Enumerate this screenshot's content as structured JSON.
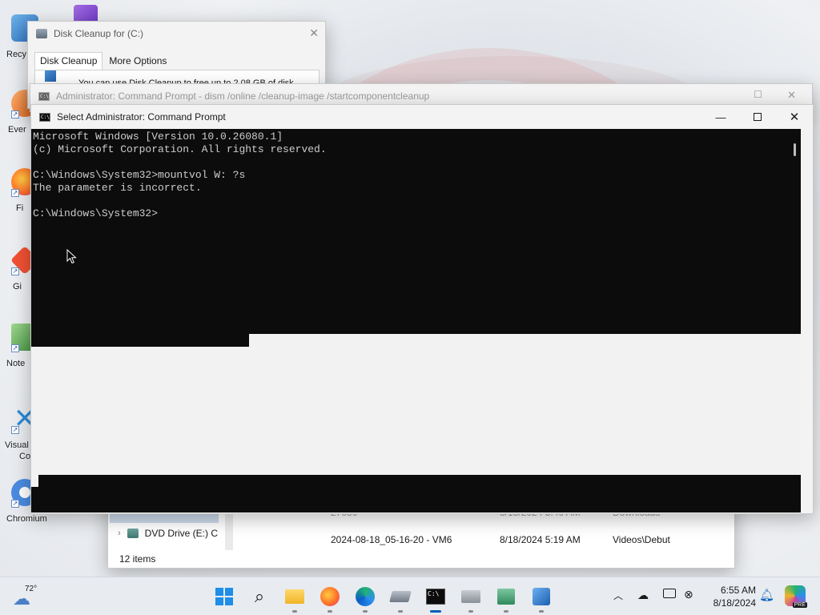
{
  "desktop": {
    "icons": [
      {
        "label": "Recy"
      },
      {
        "label": "Ever"
      },
      {
        "label": "Fi"
      },
      {
        "label": "Gi"
      },
      {
        "label": "Note"
      },
      {
        "label": "Visual"
      },
      {
        "label": "Co"
      },
      {
        "label": "Chromium"
      }
    ]
  },
  "disk_cleanup": {
    "title": "Disk Cleanup for  (C:)",
    "tabs": [
      "Disk Cleanup",
      "More Options"
    ],
    "description": "You can use Disk Cleanup to free up to 2.08 GB of disk"
  },
  "background_cmd": {
    "title": "Administrator: Command Prompt - dism /online /cleanup-image /startcomponentcleanup"
  },
  "explorer": {
    "nav_item": "DVD Drive (E:) C",
    "rows": [
      {
        "name": "27080",
        "date": "8/18/2024 5:40 AM",
        "folder": "Downloads"
      },
      {
        "name": "2024-08-18_05-16-20 - VM6",
        "date": "8/18/2024 5:19 AM",
        "folder": "Videos\\Debut"
      }
    ],
    "status": "12 items"
  },
  "cmd": {
    "title": "Select Administrator: Command Prompt",
    "output": "Microsoft Windows [Version 10.0.26080.1]\n(c) Microsoft Corporation. All rights reserved.\n\nC:\\Windows\\System32>mountvol W: ?s\nThe parameter is incorrect.\n\nC:\\Windows\\System32>"
  },
  "taskbar": {
    "weather_temp": "72°",
    "time": "6:55 AM",
    "date": "8/18/2024",
    "apps": [
      "start-icon",
      "search-icon",
      "file-explorer-icon",
      "firefox-icon",
      "edge-icon",
      "disk-cleanup-icon",
      "terminal-icon",
      "dism-icon",
      "network-icon",
      "ssms-icon"
    ],
    "pre_badge": "PRE"
  },
  "colors": {
    "console_bg": "#0c0c0c",
    "console_text": "#cccccc",
    "accent": "#005fb8"
  }
}
